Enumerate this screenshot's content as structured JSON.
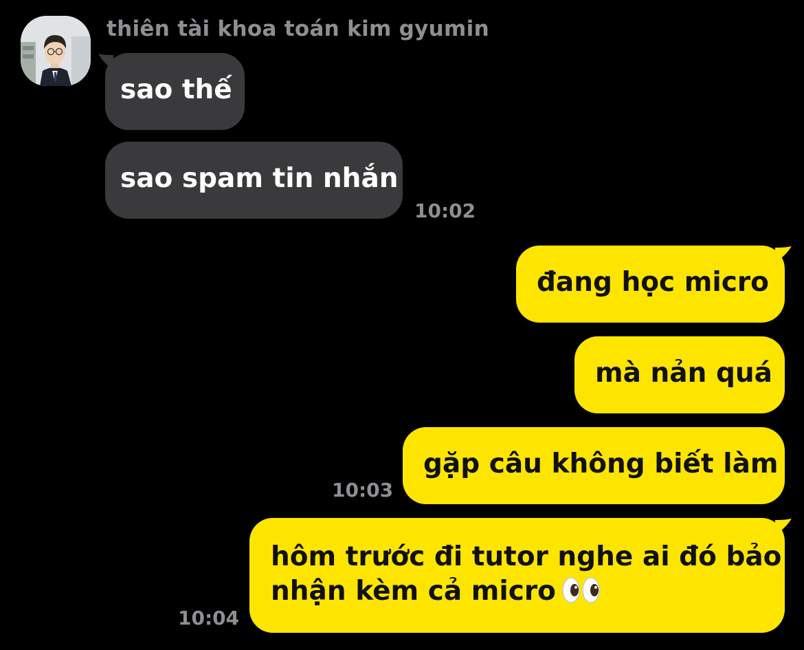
{
  "colors": {
    "background": "#000000",
    "incoming_bubble": "#3a3a3c",
    "outgoing_bubble": "#fee500",
    "meta_text": "#8e8e93"
  },
  "contact": {
    "name": "thiên tài khoa toán kim gyumin",
    "avatar_icon": "profile-photo"
  },
  "messages": {
    "incoming": [
      {
        "text": "sao thế"
      },
      {
        "text": "sao spam tin nhắn",
        "time": "10:02"
      }
    ],
    "outgoing": [
      {
        "text": "đang học micro"
      },
      {
        "text": "mà nản quá"
      },
      {
        "text": "gặp câu không biết làm",
        "time": "10:03"
      },
      {
        "lines": [
          "hôm trước đi tutor nghe ai đó bảo",
          "nhận kèm cả micro"
        ],
        "emoji": "eyes-emoji",
        "time": "10:04"
      }
    ]
  }
}
